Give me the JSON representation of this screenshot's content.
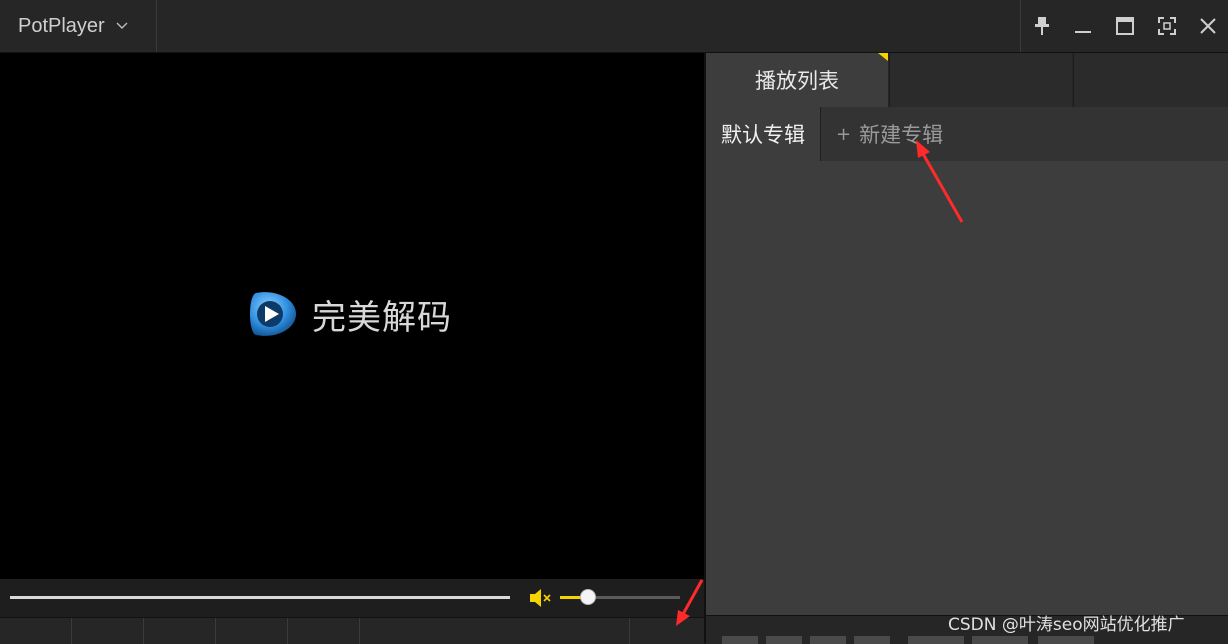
{
  "window": {
    "app_title": "PotPlayer",
    "controls": [
      "pin-icon",
      "minimize-icon",
      "maximize-icon",
      "fullscreen-icon",
      "close-icon"
    ]
  },
  "video": {
    "logo_text": "完美解码"
  },
  "volume": {
    "icon": "speaker-muted-icon",
    "level": 0.2
  },
  "playlist_panel": {
    "tabs": [
      {
        "label": "播放列表",
        "active": true
      },
      {
        "label": ""
      },
      {
        "label": ""
      }
    ],
    "albums": {
      "default_label": "默认专辑",
      "new_label": "新建专辑",
      "new_prefix": "+"
    }
  },
  "watermark": "CSDN @叶涛seo网站优化推广",
  "colors": {
    "accent": "#f5d300",
    "annotation_arrow": "#ff2a2a",
    "logo_blue": "#2f8fe0"
  }
}
